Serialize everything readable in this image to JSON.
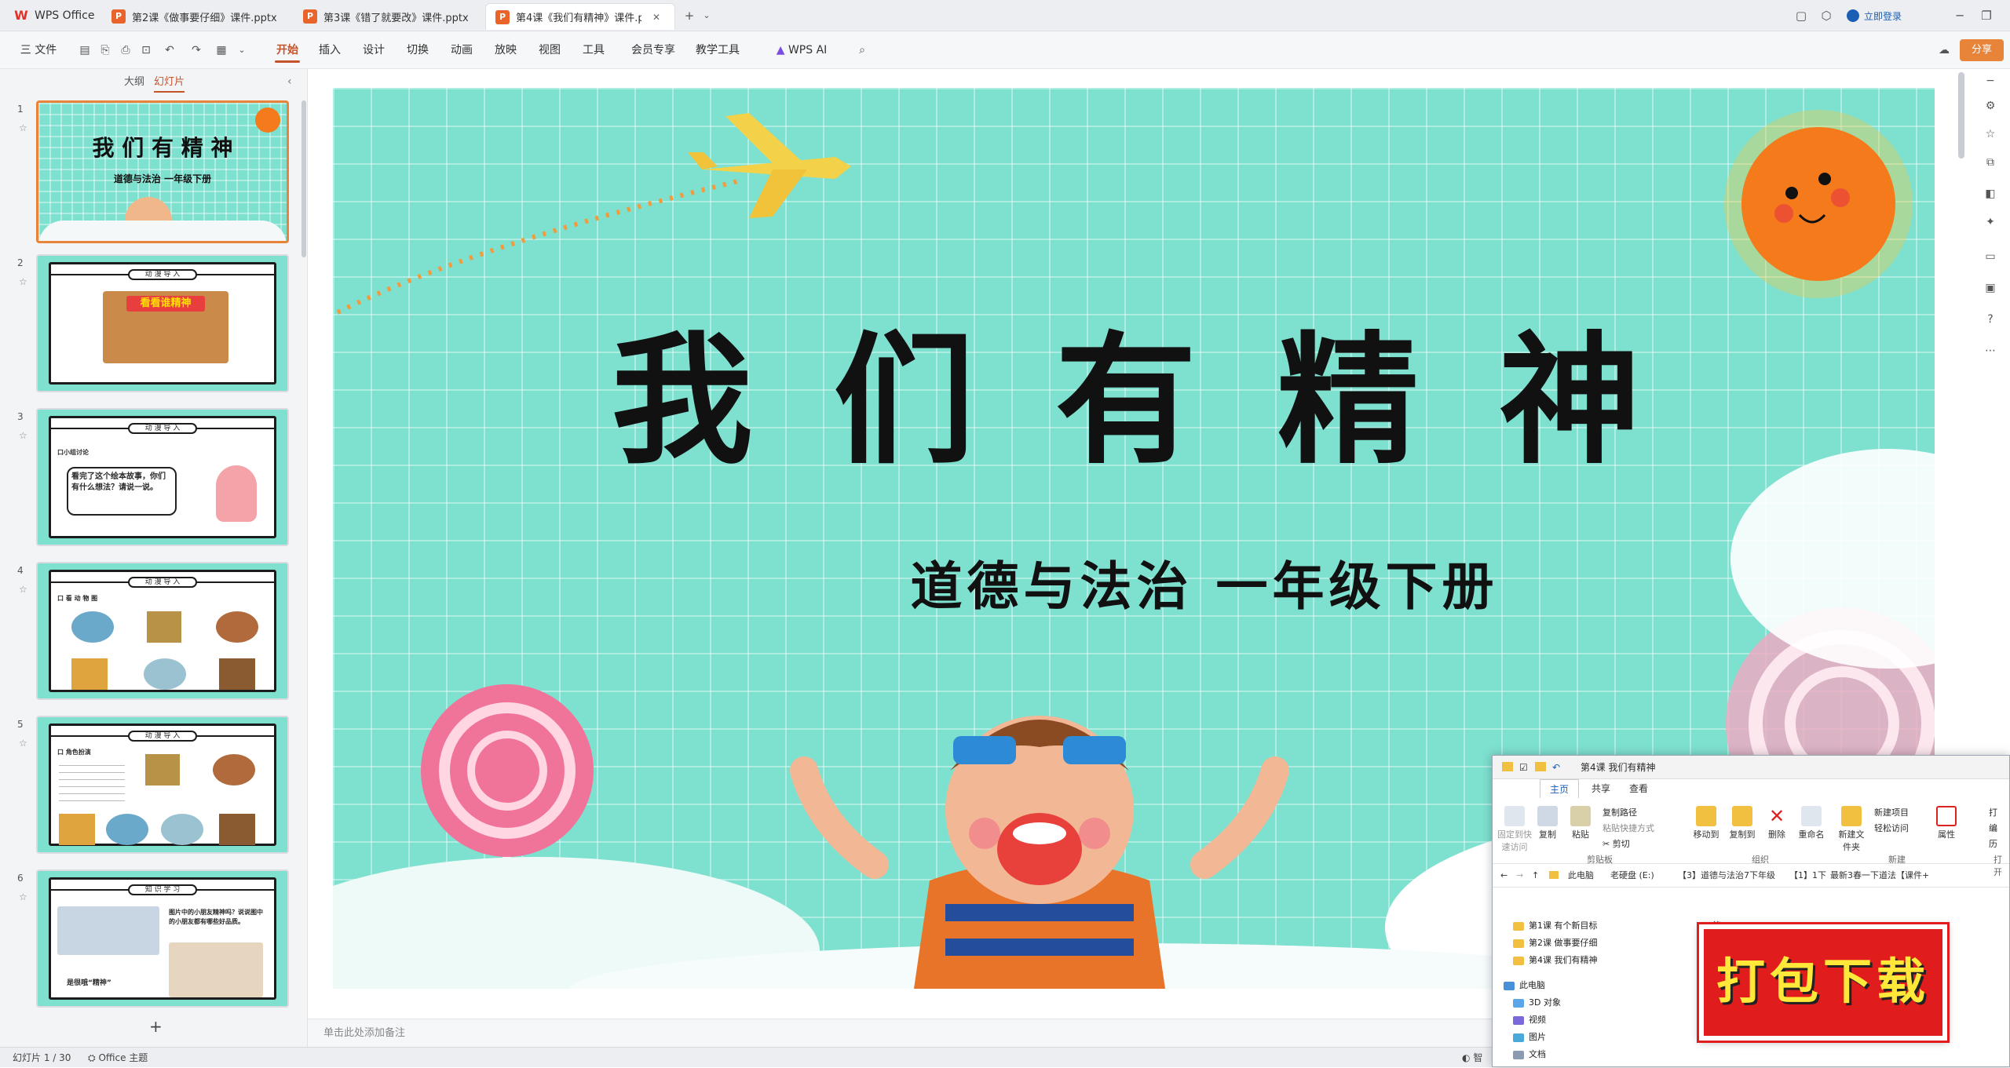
{
  "tabbar": {
    "app_name": "WPS Office",
    "tabs": [
      {
        "label": "第2课《做事要仔细》课件.pptx"
      },
      {
        "label": "第3课《错了就要改》课件.pptx"
      },
      {
        "label": "第4课《我们有精神》课件.pptx"
      }
    ],
    "login": "立即登录"
  },
  "menubar": {
    "file": "三 文件",
    "items": [
      "开始",
      "插入",
      "设计",
      "切换",
      "动画",
      "放映",
      "视图",
      "工具",
      "会员专享",
      "教学工具"
    ],
    "wps_ai": "WPS AI",
    "share": "分享"
  },
  "leftpanel": {
    "tab_outline": "大纲",
    "tab_slides": "幻灯片",
    "slide_numbers": [
      "1",
      "2",
      "3",
      "4",
      "5",
      "6"
    ],
    "thumb1_title": "我 们 有 精 神",
    "thumb1_subtitle": "道德与法治 一年级下册",
    "pill": "动 漫 导 入",
    "pill_knowledge": "知 识 学 习",
    "thumb2_banner": "看看谁精神",
    "thumb3_label": "口小组讨论",
    "thumb3_speech": "看完了这个绘本故事，你们有什么想法？请说一说。",
    "thumb4_label": "口 看 动 物 图",
    "thumb5_label": "口 角色扮演",
    "thumb6_text": "图片中的小朋友精神吗？说说图中的小朋友都有哪些好品质。",
    "thumb6_caption": "是很哦“精神”",
    "add": "+"
  },
  "slide": {
    "title": "我 们 有 精 神",
    "subtitle": "道德与法治 一年级下册"
  },
  "notes": {
    "placeholder": "单击此处添加备注"
  },
  "statusbar": {
    "slide_count": "幻灯片 1 / 30",
    "theme": "Office 主题",
    "smart": "智"
  },
  "explorer": {
    "title": "第4课 我们有精神",
    "tabs": [
      "主页",
      "共享",
      "查看"
    ],
    "ribbon": {
      "pin": "固定到快速访问",
      "copy": "复制",
      "paste": "粘贴",
      "copy_path": "复制路径",
      "paste_shortcut": "粘贴快捷方式",
      "cut": "剪切",
      "move_to": "移动到",
      "copy_to": "复制到",
      "delete": "删除",
      "rename": "重命名",
      "new_folder": "新建文件夹",
      "new_item": "新建项目",
      "easy_access": "轻松访问",
      "properties": "属性",
      "open": "打",
      "edit": "编",
      "history": "历",
      "group_clipboard": "剪贴板",
      "group_organize": "组织",
      "group_new": "新建",
      "group_open": "打开"
    },
    "address": [
      "此电脑",
      "老硬盘 (E:)",
      "【3】道德与法治7下年级",
      "【1】1下",
      "最新3春一下道法【课件+"
    ],
    "nav": [
      "第1课 有个新目标",
      "第2课 做事要仔细",
      "第4课 我们有精神",
      "此电脑",
      "3D 对象",
      "视频",
      "图片",
      "文档"
    ],
    "file": "第4"
  },
  "download_badge": "打包下载"
}
